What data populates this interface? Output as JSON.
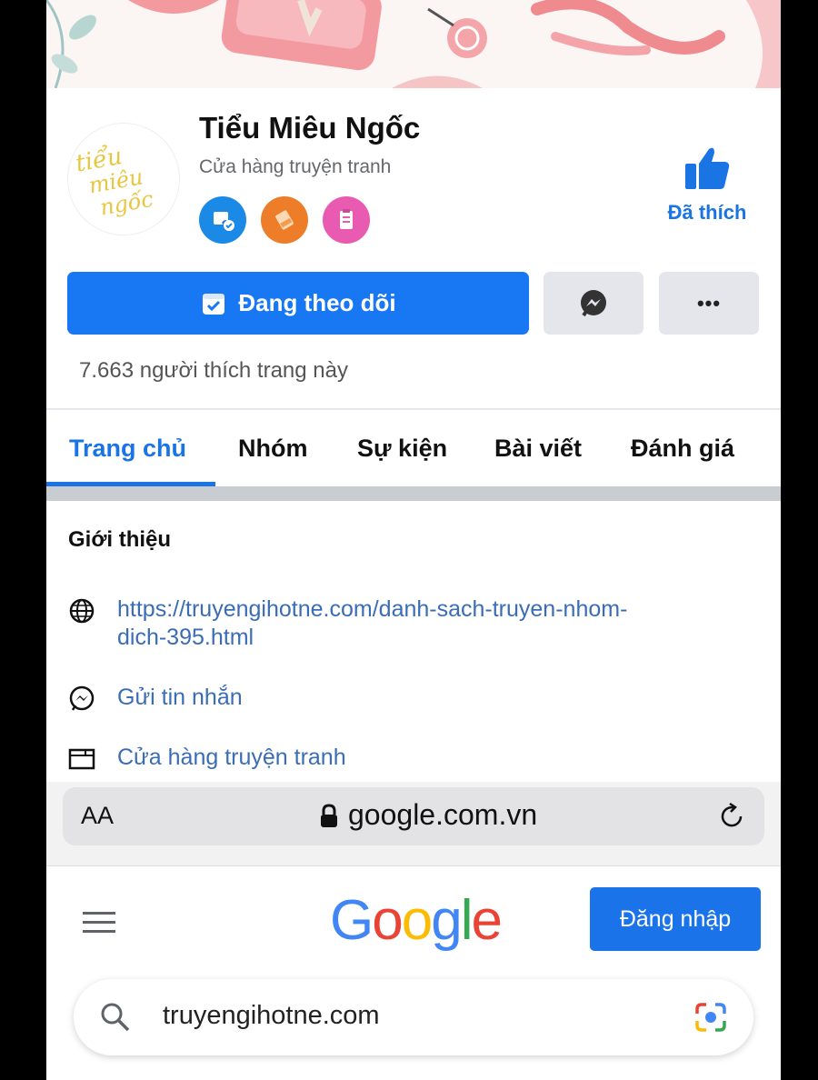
{
  "page": {
    "name": "Tiểu Miêu Ngốc",
    "category": "Cửa hàng truyện tranh",
    "avatar_text": "tiểu miêu ngốc",
    "liked_label": "Đã thích",
    "likes_count": "7.663 người thích trang này"
  },
  "actions": {
    "following_label": "Đang theo dõi",
    "messenger": "messenger-icon",
    "more": "•••"
  },
  "tabs": [
    "Trang chủ",
    "Nhóm",
    "Sự kiện",
    "Bài viết",
    "Đánh giá"
  ],
  "intro": {
    "title": "Giới thiệu",
    "website_line1": "https://truyengihotne.com/danh-sach-truyen-nhom-",
    "website_line2": "dich-395.html",
    "message": "Gửi tin nhắn",
    "category": "Cửa hàng truyện tranh"
  },
  "browser": {
    "text_size": "AA",
    "url": "google.com.vn"
  },
  "google": {
    "logo": [
      "G",
      "o",
      "o",
      "g",
      "l",
      "e"
    ],
    "logo_colors": [
      "#4285f4",
      "#ea4335",
      "#fbbc05",
      "#4285f4",
      "#34a853",
      "#ea4335"
    ],
    "signin_label": "Đăng nhập",
    "search_query": "truyengihotne.com"
  },
  "colors": {
    "facebook_blue": "#1877f2",
    "link_blue": "#3a6db5"
  }
}
